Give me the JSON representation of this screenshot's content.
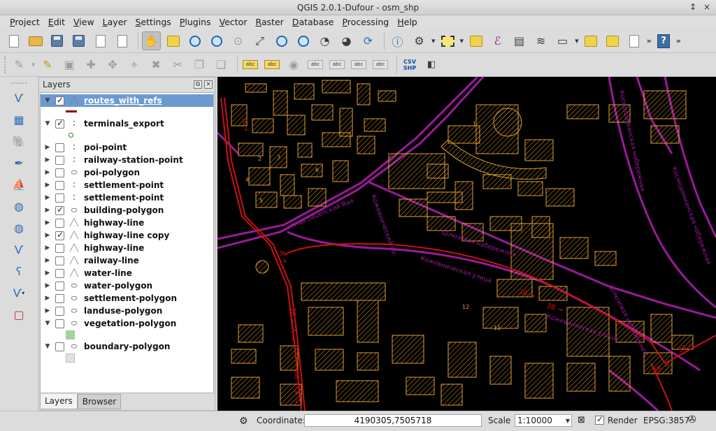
{
  "window": {
    "title": "QGIS 2.0.1-Dufour - osm_shp",
    "controls": [
      "↕",
      "×"
    ]
  },
  "menubar": [
    "Project",
    "Edit",
    "View",
    "Layer",
    "Settings",
    "Plugins",
    "Vector",
    "Raster",
    "Database",
    "Processing",
    "Help"
  ],
  "layers_panel": {
    "title": "Layers",
    "layers": [
      {
        "name": "routes_with_refs",
        "checked": true,
        "expanded": true,
        "type": "line",
        "selected": true,
        "legend_color": "#8b0000"
      },
      {
        "name": "terminals_export",
        "checked": true,
        "expanded": true,
        "type": "point",
        "legend_color": "#2e7d32"
      },
      {
        "name": "poi-point",
        "checked": false,
        "expanded": false,
        "type": "point"
      },
      {
        "name": "railway-station-point",
        "checked": false,
        "expanded": false,
        "type": "point"
      },
      {
        "name": "poi-polygon",
        "checked": false,
        "expanded": false,
        "type": "polygon"
      },
      {
        "name": "settlement-point",
        "checked": false,
        "expanded": false,
        "type": "point"
      },
      {
        "name": "settlement-point",
        "checked": false,
        "expanded": false,
        "type": "point"
      },
      {
        "name": "building-polygon",
        "checked": true,
        "expanded": false,
        "type": "polygon"
      },
      {
        "name": "highway-line",
        "checked": false,
        "expanded": false,
        "type": "line"
      },
      {
        "name": "highway-line copy",
        "checked": true,
        "expanded": false,
        "type": "line"
      },
      {
        "name": "highway-line",
        "checked": false,
        "expanded": false,
        "type": "line"
      },
      {
        "name": "railway-line",
        "checked": false,
        "expanded": false,
        "type": "line"
      },
      {
        "name": "water-line",
        "checked": false,
        "expanded": false,
        "type": "line"
      },
      {
        "name": "water-polygon",
        "checked": false,
        "expanded": false,
        "type": "polygon"
      },
      {
        "name": "settlement-polygon",
        "checked": false,
        "expanded": false,
        "type": "polygon"
      },
      {
        "name": "landuse-polygon",
        "checked": false,
        "expanded": false,
        "type": "polygon"
      },
      {
        "name": "vegetation-polygon",
        "checked": false,
        "expanded": true,
        "type": "polygon",
        "legend_color": "#9fd49a"
      },
      {
        "name": "boundary-polygon",
        "checked": false,
        "expanded": true,
        "type": "polygon",
        "legend_color": "#e2e2dc"
      }
    ],
    "tabs": [
      "Layers",
      "Browser"
    ]
  },
  "map": {
    "background": "#000000",
    "building_color": "#e0a030",
    "road_color": "#9a1a9a",
    "route_color": "#cc1111",
    "street_labels": [
      "Шлюзовая набережная",
      "улица Зацепский Вал",
      "Кожевническая улица",
      "Космодамианская набережная",
      "Кожевнический пр."
    ],
    "route_labels": [
      "38",
      "A"
    ],
    "house_numbers": [
      "1",
      "2",
      "3",
      "4",
      "5",
      "6",
      "11",
      "12"
    ]
  },
  "statusbar": {
    "coordinate_label": "Coordinate:",
    "coordinate_value": "4190305,7505718",
    "scale_label": "Scale",
    "scale_value": "1:10000",
    "render_label": "Render",
    "render_checked": true,
    "crs": "EPSG:3857"
  }
}
